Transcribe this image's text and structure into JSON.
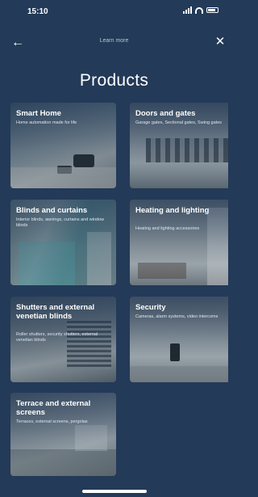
{
  "status": {
    "time": "15:10"
  },
  "nav": {
    "title": "Learn more",
    "back_icon": "back-arrow-icon",
    "close_icon": "close-icon"
  },
  "page": {
    "title": "Products"
  },
  "cards": [
    {
      "title": "Smart Home",
      "description": "Home automation made for life"
    },
    {
      "title": "Doors and gates",
      "description": "Garage gates, Sectional gates, Swing gates"
    },
    {
      "title": "Blinds and curtains",
      "description": "Interior blinds, awnings, curtains and window blinds"
    },
    {
      "title": "Heating and lighting",
      "description": "Heating and lighting accessories"
    },
    {
      "title": "Shutters and external venetian blinds",
      "description": "Roller shutters, security shutters, external venetian blinds"
    },
    {
      "title": "Security",
      "description": "Cameras, alarm systems, video intercoms"
    },
    {
      "title": "Terrace and external screens",
      "description": "Terraces, external screens, pergolas"
    }
  ],
  "colors": {
    "background": "#233a58",
    "text": "#ffffff"
  }
}
